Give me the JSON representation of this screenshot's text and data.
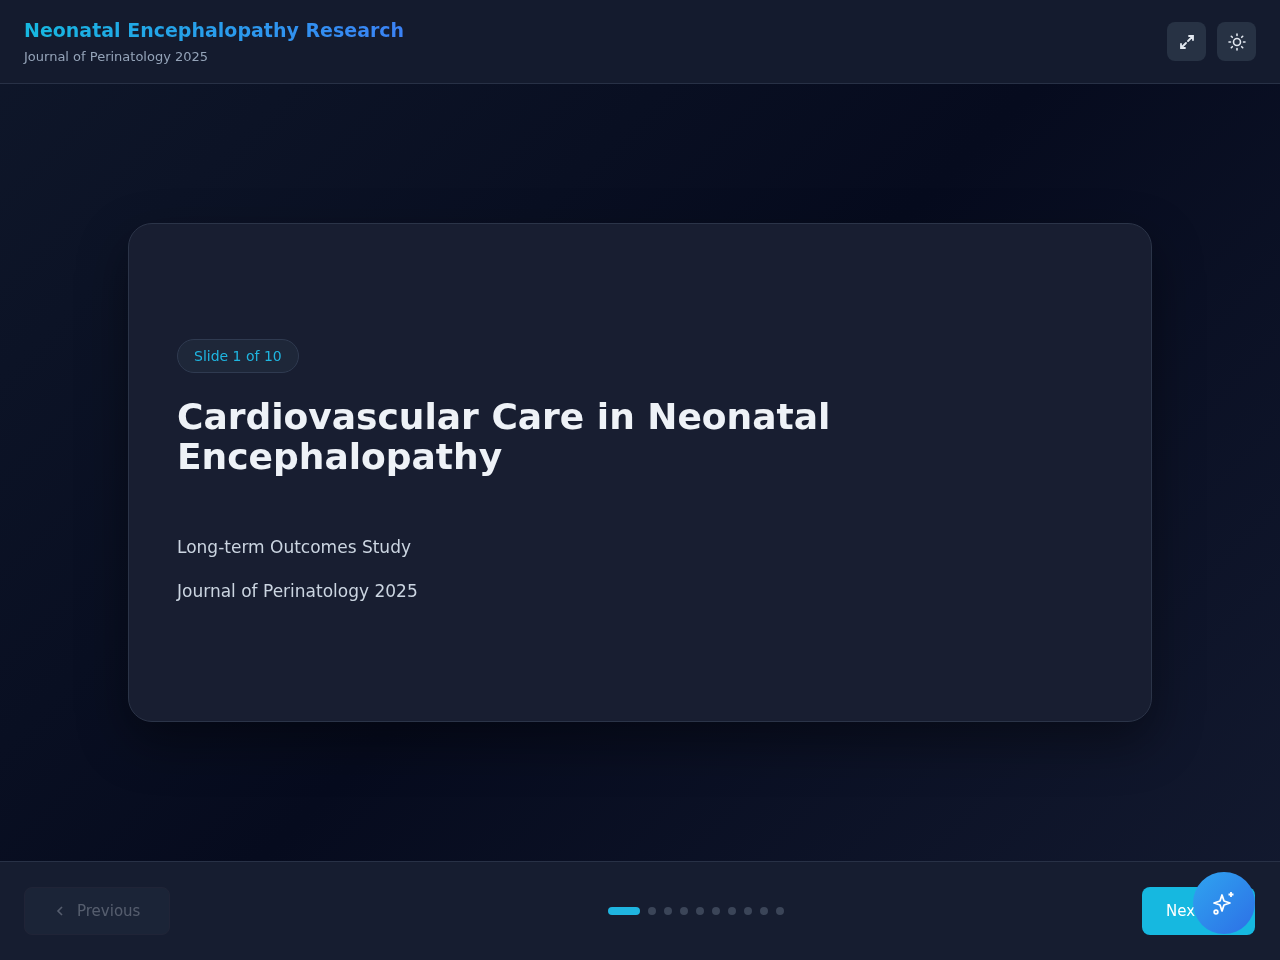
{
  "header": {
    "title": "Neonatal Encephalopathy Research",
    "subtitle": "Journal of Perinatology 2025"
  },
  "slide": {
    "badge": "Slide 1 of 10",
    "title": "Cardiovascular Care in Neonatal Encephalopathy",
    "lines": [
      "Long-term Outcomes Study",
      "Journal of Perinatology 2025"
    ]
  },
  "footer": {
    "previous": {
      "label": "Previous",
      "disabled": true
    },
    "next": {
      "label": "Nex",
      "disabled": false
    },
    "dots": [
      {
        "selected": true
      },
      {
        "selected": false
      },
      {
        "selected": false
      },
      {
        "selected": false
      },
      {
        "selected": false
      },
      {
        "selected": false
      },
      {
        "selected": false
      },
      {
        "selected": false
      },
      {
        "selected": false
      },
      {
        "selected": false
      }
    ]
  }
}
